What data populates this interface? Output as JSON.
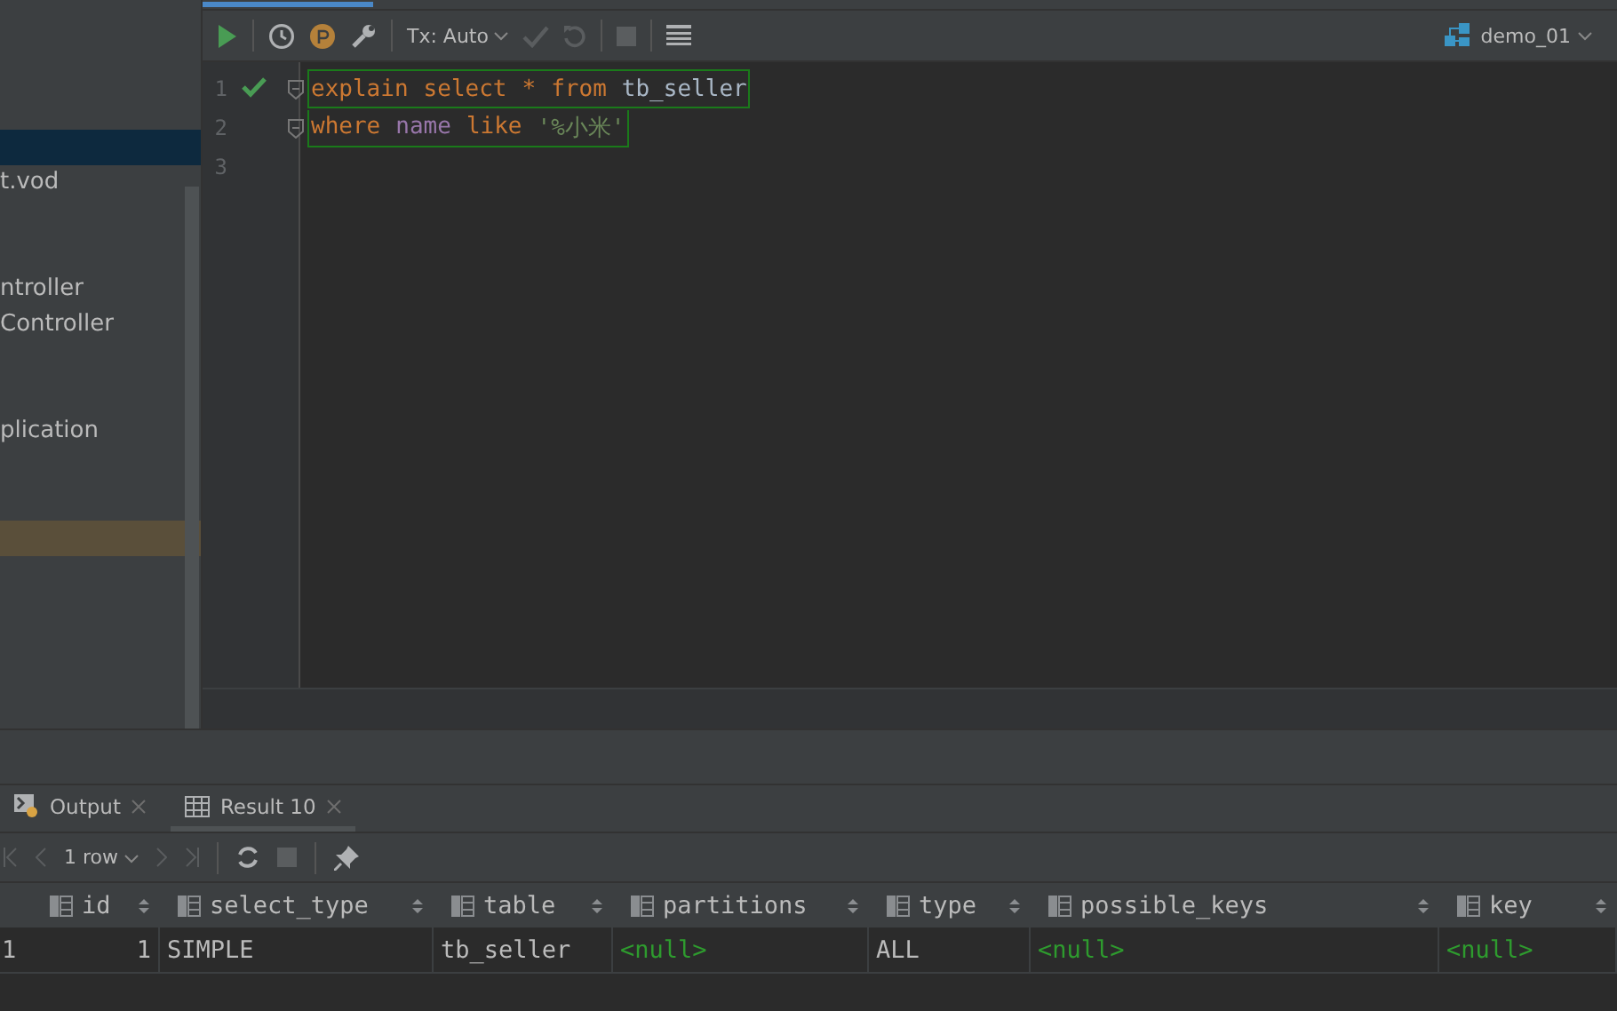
{
  "sidebar": {
    "rows": [
      {
        "selected": false,
        "marked": false
      },
      {
        "selected": false,
        "marked": false
      },
      {
        "selected": true,
        "marked": false
      },
      {
        "label": "t.vod",
        "selected": false,
        "marked": false
      },
      {
        "selected": false,
        "marked": false
      },
      {
        "selected": false,
        "marked": false
      },
      {
        "label": "ntroller",
        "selected": false,
        "marked": false
      },
      {
        "label": "Controller",
        "selected": false,
        "marked": false
      },
      {
        "selected": false,
        "marked": false
      },
      {
        "selected": false,
        "marked": false
      },
      {
        "label": "plication",
        "selected": false,
        "marked": false
      },
      {
        "selected": false,
        "marked": false
      },
      {
        "selected": false,
        "marked": false
      },
      {
        "selected": false,
        "marked": true
      }
    ]
  },
  "toolbar": {
    "tx_mode": "Tx: Auto",
    "datasource": "demo_01"
  },
  "editor": {
    "lines": [
      {
        "number": "1",
        "ok": true,
        "fold": true,
        "tokens": [
          {
            "kind": "keyword",
            "text": "explain"
          },
          {
            "kind": "keyword",
            "text": "select"
          },
          {
            "kind": "keyword",
            "text": "*"
          },
          {
            "kind": "keyword",
            "text": "from"
          },
          {
            "kind": "ident",
            "text": "tb_seller"
          }
        ]
      },
      {
        "number": "2",
        "ok": false,
        "fold": true,
        "tokens": [
          {
            "kind": "keyword",
            "text": "where"
          },
          {
            "kind": "column",
            "text": "name"
          },
          {
            "kind": "keyword",
            "text": "like"
          },
          {
            "kind": "string",
            "text": "'%小米'"
          }
        ]
      },
      {
        "number": "3",
        "ok": false,
        "fold": false
      }
    ]
  },
  "bottom_tabs": [
    {
      "label": "Output",
      "kind": "output",
      "selected": false
    },
    {
      "label": "Result 10",
      "kind": "grid",
      "selected": true
    }
  ],
  "result_toolbar": {
    "row_count": "1 row"
  },
  "table": {
    "columns": [
      {
        "label": "id"
      },
      {
        "label": "select_type"
      },
      {
        "label": "table"
      },
      {
        "label": "partitions"
      },
      {
        "label": "type"
      },
      {
        "label": "possible_keys"
      },
      {
        "label": "key"
      }
    ],
    "rows": [
      {
        "number": "1",
        "cells": [
          {
            "text": "1",
            "kind": "number"
          },
          {
            "text": "SIMPLE",
            "kind": "text"
          },
          {
            "text": "tb_seller",
            "kind": "text"
          },
          {
            "text": "<null>",
            "kind": "null"
          },
          {
            "text": "ALL",
            "kind": "text"
          },
          {
            "text": "<null>",
            "kind": "null"
          },
          {
            "text": "<null>",
            "kind": "null"
          }
        ]
      }
    ]
  }
}
